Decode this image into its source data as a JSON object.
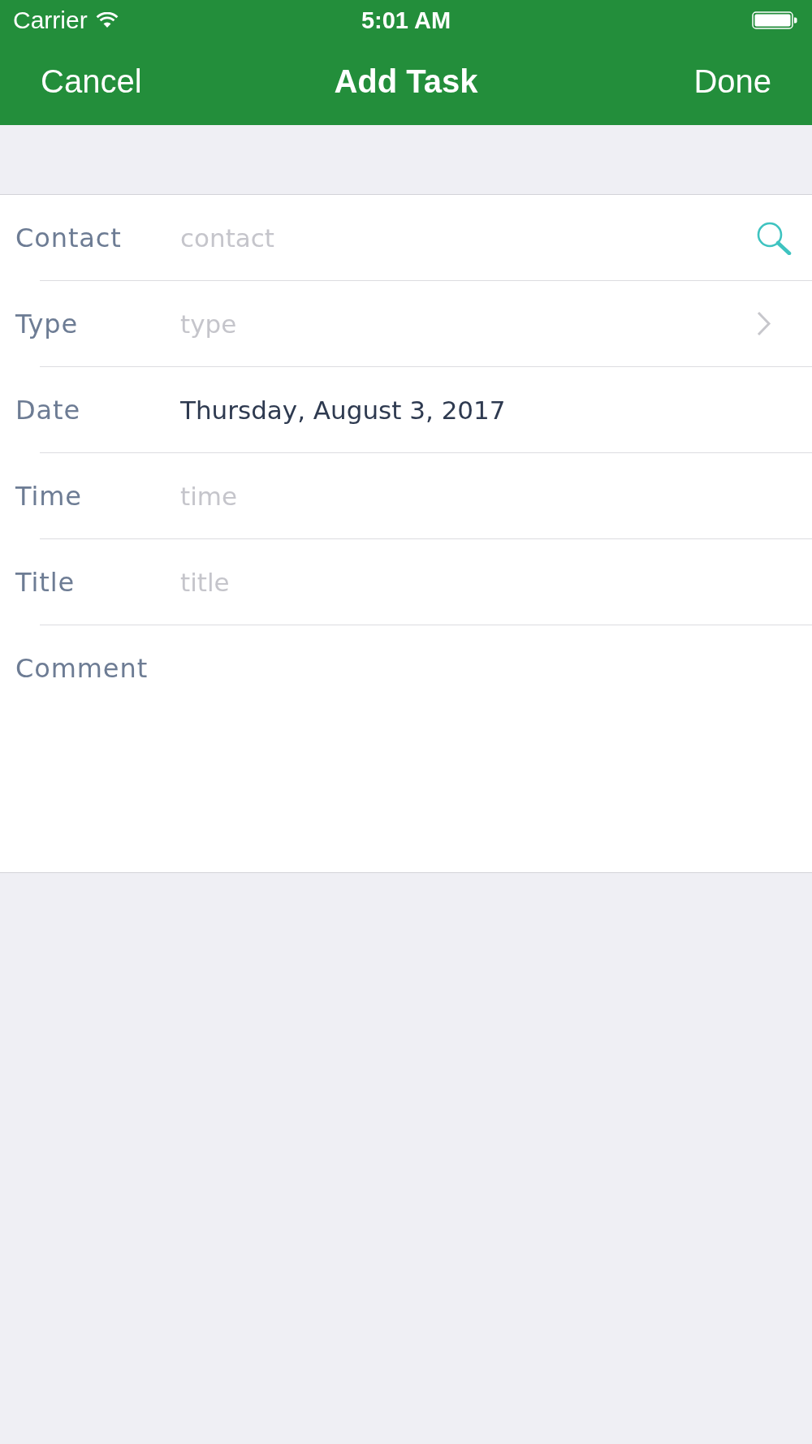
{
  "status_bar": {
    "carrier": "Carrier",
    "time": "5:01 AM"
  },
  "nav_bar": {
    "left_button": "Cancel",
    "title": "Add Task",
    "right_button": "Done"
  },
  "form": {
    "rows": [
      {
        "kind": "search",
        "label": "Contact",
        "placeholder": "contact"
      },
      {
        "kind": "picker",
        "label": "Type",
        "placeholder": "type"
      },
      {
        "kind": "text",
        "label": "Date",
        "value": "Thursday, August 3, 2017"
      },
      {
        "kind": "text",
        "label": "Time",
        "placeholder": "time"
      },
      {
        "kind": "text",
        "label": "Title",
        "placeholder": "title"
      },
      {
        "kind": "textarea",
        "label": "Comment"
      }
    ]
  }
}
